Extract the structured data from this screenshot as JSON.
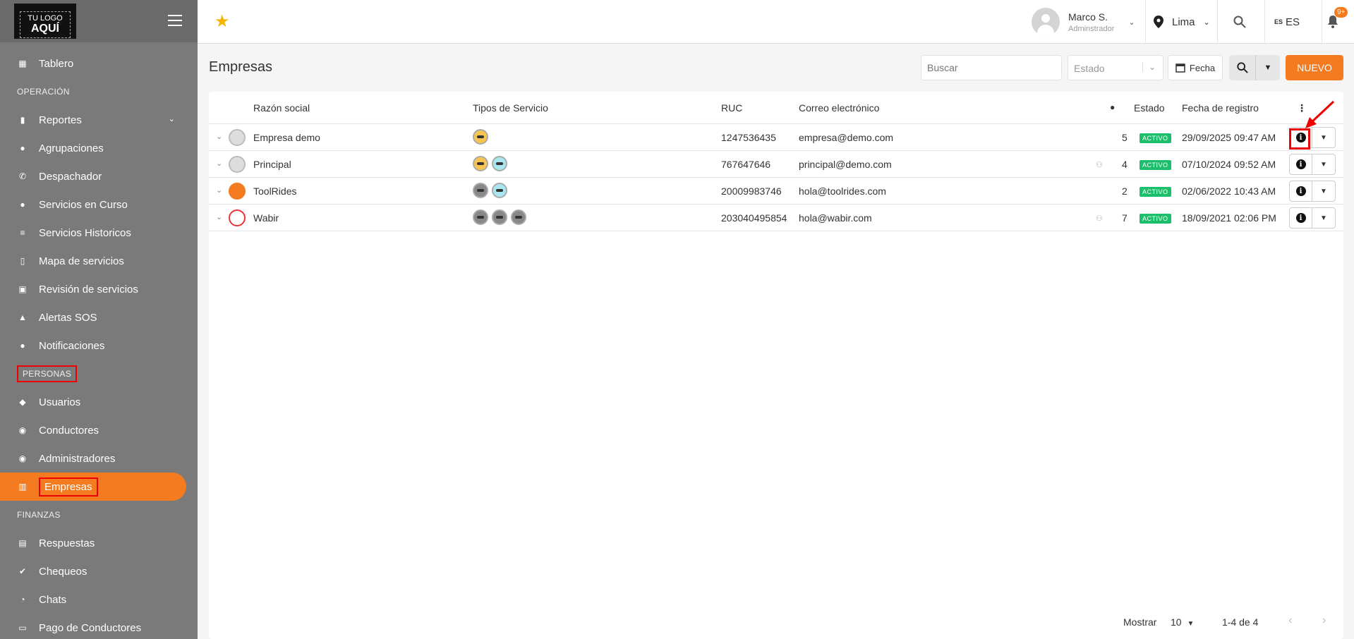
{
  "logo": {
    "line1": "TU LOGO",
    "line2": "AQUÍ"
  },
  "sidebar": {
    "items": [
      {
        "type": "item",
        "label": "Tablero",
        "icon": "dashboard-icon",
        "glyph": "▦"
      },
      {
        "type": "section",
        "label": "OPERACIÓN"
      },
      {
        "type": "item",
        "label": "Reportes",
        "icon": "bar-chart-icon",
        "glyph": "▮",
        "chevron": "⌄"
      },
      {
        "type": "item",
        "label": "Agrupaciones",
        "icon": "groups-icon",
        "glyph": "●"
      },
      {
        "type": "item",
        "label": "Despachador",
        "icon": "phone-icon",
        "glyph": "✆"
      },
      {
        "type": "item",
        "label": "Servicios en Curso",
        "icon": "in-progress-icon",
        "glyph": "●"
      },
      {
        "type": "item",
        "label": "Servicios Historicos",
        "icon": "list-icon",
        "glyph": "≡"
      },
      {
        "type": "item",
        "label": "Mapa de servicios",
        "icon": "map-icon",
        "glyph": "▯"
      },
      {
        "type": "item",
        "label": "Revisión de servicios",
        "icon": "review-icon",
        "glyph": "▣"
      },
      {
        "type": "item",
        "label": "Alertas SOS",
        "icon": "warning-icon",
        "glyph": "▲"
      },
      {
        "type": "item",
        "label": "Notificaciones",
        "icon": "bell-icon",
        "glyph": "●"
      },
      {
        "type": "section",
        "label": "PERSONAS",
        "highlight": true
      },
      {
        "type": "item",
        "label": "Usuarios",
        "icon": "users-icon",
        "glyph": "◆"
      },
      {
        "type": "item",
        "label": "Conductores",
        "icon": "steering-wheel-icon",
        "glyph": "◉"
      },
      {
        "type": "item",
        "label": "Administradores",
        "icon": "admin-icon",
        "glyph": "◉"
      },
      {
        "type": "item",
        "label": "Empresas",
        "icon": "building-icon",
        "glyph": "▥",
        "active": true
      },
      {
        "type": "section",
        "label": "FINANZAS"
      },
      {
        "type": "item",
        "label": "Respuestas",
        "icon": "answers-icon",
        "glyph": "▤"
      },
      {
        "type": "item",
        "label": "Chequeos",
        "icon": "shield-check-icon",
        "glyph": "✔"
      },
      {
        "type": "item",
        "label": "Chats",
        "icon": "chat-icon",
        "glyph": "◔"
      },
      {
        "type": "item",
        "label": "Pago de Conductores",
        "icon": "payment-icon",
        "glyph": "▭"
      }
    ]
  },
  "topbar": {
    "user_name": "Marco S.",
    "user_role": "Adminstrador",
    "city": "Lima",
    "lang_code": "ES",
    "lang_label": "ES",
    "notif_badge": "9+"
  },
  "page": {
    "title": "Empresas",
    "search_placeholder": "Buscar",
    "estado_placeholder": "Estado",
    "fecha_label": "Fecha",
    "new_label": "NUEVO"
  },
  "table": {
    "headers": {
      "razon": "Razón social",
      "tipos": "Tipos de Servicio",
      "ruc": "RUC",
      "correo": "Correo electrónico",
      "estado": "Estado",
      "fecha": "Fecha de registro"
    },
    "rows": [
      {
        "name": "Empresa demo",
        "services": [
          "taxi"
        ],
        "ruc": "1247536435",
        "email": "empresa@demo.com",
        "count": "5",
        "status": "ACTIVO",
        "date": "29/09/2025 09:47 AM",
        "logo": "placeholder",
        "flag": false
      },
      {
        "name": "Principal",
        "services": [
          "taxi",
          "blue"
        ],
        "ruc": "767647646",
        "email": "principal@demo.com",
        "count": "4",
        "status": "ACTIVO",
        "date": "07/10/2024 09:52 AM",
        "logo": "placeholder",
        "flag": true
      },
      {
        "name": "ToolRides",
        "services": [
          "gray",
          "blue"
        ],
        "ruc": "20009983746",
        "email": "hola@toolrides.com",
        "count": "2",
        "status": "ACTIVO",
        "date": "02/06/2022 10:43 AM",
        "logo": "orange",
        "flag": false
      },
      {
        "name": "Wabir",
        "services": [
          "gray",
          "gray",
          "gray"
        ],
        "ruc": "203040495854",
        "email": "hola@wabir.com",
        "count": "7",
        "status": "ACTIVO",
        "date": "18/09/2021 02:06 PM",
        "logo": "red",
        "flag": true
      }
    ]
  },
  "footer": {
    "show_label": "Mostrar",
    "page_size": "10",
    "range": "1-4 de 4"
  },
  "colors": {
    "accent": "#f47b20",
    "active_badge": "#1bbf6b",
    "sidebar": "#7a7a7a"
  }
}
